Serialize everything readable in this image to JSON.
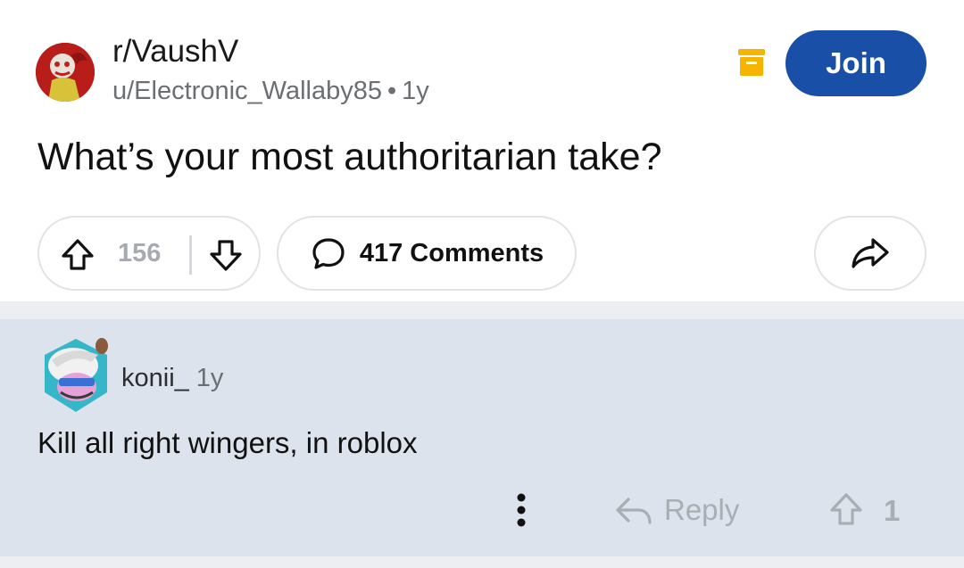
{
  "post": {
    "subreddit": "r/VaushV",
    "author": "u/Electronic_Wallaby85",
    "separator": "•",
    "age": "1y",
    "title": "What’s your most authoritarian take?",
    "join_label": "Join",
    "upvotes": "156",
    "comments_label": "417 Comments",
    "icons": {
      "archive": "archive-icon",
      "upvote": "arrow-up-icon",
      "downvote": "arrow-down-icon",
      "comment": "speech-bubble-icon",
      "share": "share-arrow-icon"
    }
  },
  "comment": {
    "username": "konii_",
    "age": "1y",
    "body": "Kill all right wingers, in roblox",
    "reply_label": "Reply",
    "score": "1",
    "icons": {
      "more": "vertical-dots-icon",
      "reply": "reply-arrow-icon",
      "upvote": "arrow-up-icon"
    }
  },
  "colors": {
    "join_button": "#1a4fa8",
    "archive_icon": "#f5b400",
    "comment_background": "#dde3ec",
    "muted_text": "#a9adb4"
  }
}
